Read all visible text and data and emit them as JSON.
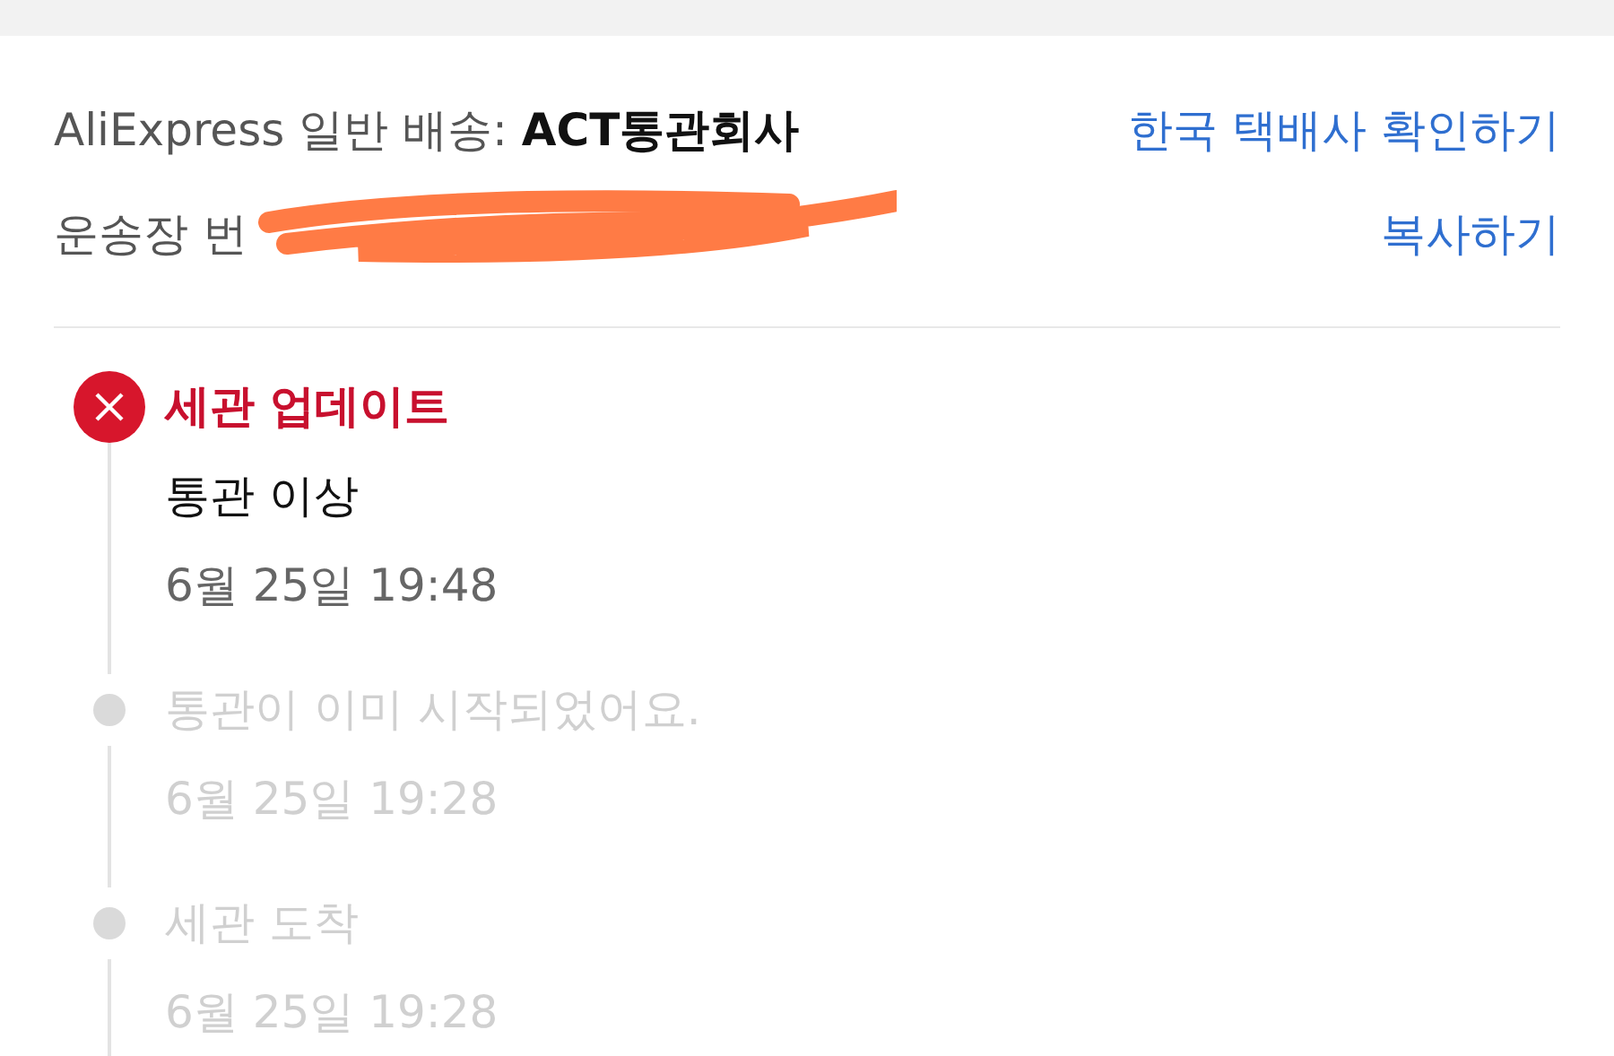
{
  "shipping": {
    "carrier_label": "AliExpress 일반 배송: ",
    "carrier_name": "ACT통관회사",
    "carrier_link": "한국 택배사 확인하기",
    "tracking_label": "운송장 번",
    "copy_link": "복사하기"
  },
  "events": [
    {
      "kind": "alert",
      "title": "세관 업데이트",
      "detail": "통관 이상",
      "time": "6월 25일 19:48"
    },
    {
      "kind": "past",
      "title": "통관이 이미 시작되었어요.",
      "time": "6월 25일 19:28"
    },
    {
      "kind": "past",
      "title": "세관 도착",
      "time": "6월 25일 19:28"
    }
  ]
}
